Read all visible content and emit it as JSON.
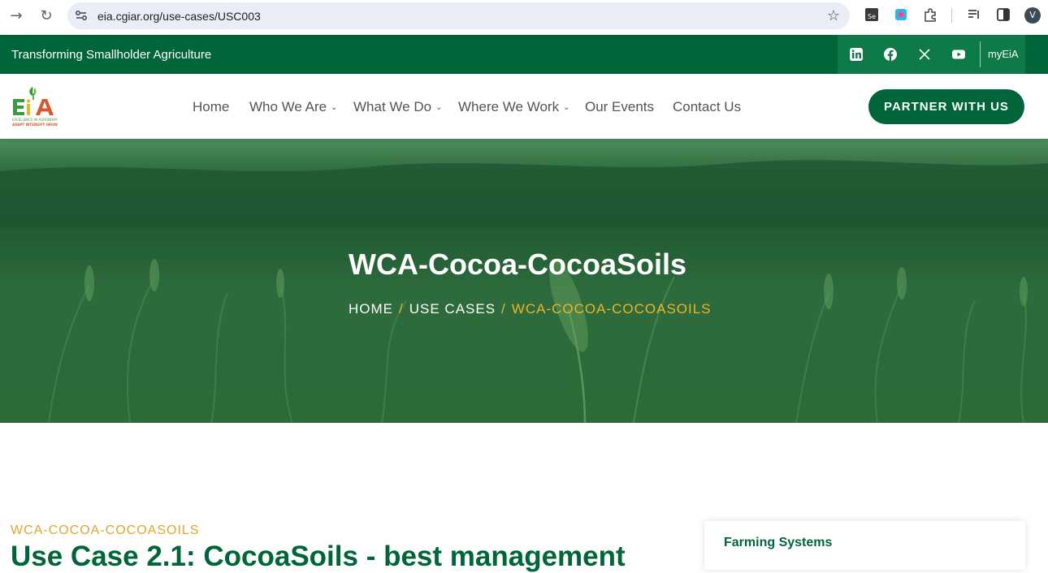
{
  "browser": {
    "url": "eia.cgiar.org/use-cases/USC003",
    "avatar_letter": "V",
    "extension_label": "Se"
  },
  "topbar": {
    "tagline": "Transforming Smallholder Agriculture",
    "social_icons": [
      "linkedin-icon",
      "facebook-icon",
      "x-icon",
      "youtube-icon"
    ],
    "myeia_label": "myEiA"
  },
  "logo": {
    "mark": "EiA",
    "line1": "EXCELLENCE IN AGRONOMY",
    "line2": "ADAPT INTENSIFY GROW"
  },
  "nav": {
    "items": [
      {
        "label": "Home",
        "has_dropdown": false
      },
      {
        "label": "Who We Are",
        "has_dropdown": true
      },
      {
        "label": "What We Do",
        "has_dropdown": true
      },
      {
        "label": "Where We Work",
        "has_dropdown": true
      },
      {
        "label": "Our Events",
        "has_dropdown": false
      },
      {
        "label": "Contact Us",
        "has_dropdown": false
      }
    ],
    "cta_label": "PARTNER WITH US"
  },
  "hero": {
    "title": "WCA-Cocoa-CocoaSoils",
    "breadcrumb": [
      "HOME",
      "USE CASES",
      "WCA-COCOA-COCOASOILS"
    ]
  },
  "content": {
    "kicker": "WCA-COCOA-COCOASOILS",
    "heading": "Use Case 2.1: CocoaSoils - best management"
  },
  "sidebar": {
    "card_title": "Farming Systems"
  },
  "colors": {
    "brand_green": "#00663a",
    "accent_gold": "#f2b322",
    "kicker_gold": "#e0a52f"
  }
}
